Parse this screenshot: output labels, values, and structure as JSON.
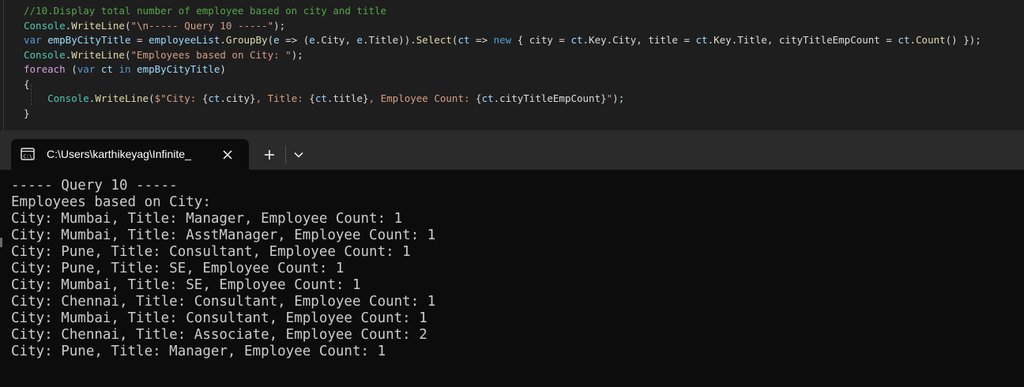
{
  "editor": {
    "lines": [
      [
        {
          "t": "//10.Display total number of employee based on city and title",
          "c": "c-comment"
        }
      ],
      [
        {
          "t": "Console",
          "c": "c-type"
        },
        {
          "t": ".",
          "c": "c-plain"
        },
        {
          "t": "WriteLine",
          "c": "c-method"
        },
        {
          "t": "(",
          "c": "c-plain"
        },
        {
          "t": "\"\\n----- Query 10 -----\"",
          "c": "c-str"
        },
        {
          "t": ");",
          "c": "c-plain"
        }
      ],
      [
        {
          "t": "var",
          "c": "c-kw"
        },
        {
          "t": " ",
          "c": "c-plain"
        },
        {
          "t": "empByCityTitle",
          "c": "c-var"
        },
        {
          "t": " = ",
          "c": "c-plain"
        },
        {
          "t": "employeeList",
          "c": "c-var"
        },
        {
          "t": ".",
          "c": "c-plain"
        },
        {
          "t": "GroupBy",
          "c": "c-method"
        },
        {
          "t": "(",
          "c": "c-plain"
        },
        {
          "t": "e",
          "c": "c-var"
        },
        {
          "t": " => (",
          "c": "c-plain"
        },
        {
          "t": "e",
          "c": "c-var"
        },
        {
          "t": ".City, ",
          "c": "c-plain"
        },
        {
          "t": "e",
          "c": "c-var"
        },
        {
          "t": ".Title)).",
          "c": "c-plain"
        },
        {
          "t": "Select",
          "c": "c-method"
        },
        {
          "t": "(",
          "c": "c-plain"
        },
        {
          "t": "ct",
          "c": "c-var"
        },
        {
          "t": " => ",
          "c": "c-plain"
        },
        {
          "t": "new",
          "c": "c-kw"
        },
        {
          "t": " { city = ",
          "c": "c-plain"
        },
        {
          "t": "ct",
          "c": "c-var"
        },
        {
          "t": ".Key.City, title = ",
          "c": "c-plain"
        },
        {
          "t": "ct",
          "c": "c-var"
        },
        {
          "t": ".Key.Title, cityTitleEmpCount = ",
          "c": "c-plain"
        },
        {
          "t": "ct",
          "c": "c-var"
        },
        {
          "t": ".",
          "c": "c-plain"
        },
        {
          "t": "Count",
          "c": "c-method"
        },
        {
          "t": "() });",
          "c": "c-plain"
        }
      ],
      [
        {
          "t": "Console",
          "c": "c-type"
        },
        {
          "t": ".",
          "c": "c-plain"
        },
        {
          "t": "WriteLine",
          "c": "c-method"
        },
        {
          "t": "(",
          "c": "c-plain"
        },
        {
          "t": "\"Employees based on City: \"",
          "c": "c-str"
        },
        {
          "t": ");",
          "c": "c-plain"
        }
      ],
      [
        {
          "t": "foreach",
          "c": "c-ctl"
        },
        {
          "t": " (",
          "c": "c-plain"
        },
        {
          "t": "var",
          "c": "c-kw"
        },
        {
          "t": " ",
          "c": "c-plain"
        },
        {
          "t": "ct",
          "c": "c-var"
        },
        {
          "t": " ",
          "c": "c-plain"
        },
        {
          "t": "in",
          "c": "c-kw"
        },
        {
          "t": " ",
          "c": "c-plain"
        },
        {
          "t": "empByCityTitle",
          "c": "c-var"
        },
        {
          "t": ")",
          "c": "c-plain"
        }
      ],
      [
        {
          "t": "{",
          "c": "c-plain"
        }
      ],
      [
        {
          "t": "    ",
          "c": "c-plain"
        },
        {
          "t": "Console",
          "c": "c-type"
        },
        {
          "t": ".",
          "c": "c-plain"
        },
        {
          "t": "WriteLine",
          "c": "c-method"
        },
        {
          "t": "(",
          "c": "c-plain"
        },
        {
          "t": "$\"City: ",
          "c": "c-str"
        },
        {
          "t": "{",
          "c": "c-plain"
        },
        {
          "t": "ct",
          "c": "c-var"
        },
        {
          "t": ".city}",
          "c": "c-plain"
        },
        {
          "t": ", Title: ",
          "c": "c-str"
        },
        {
          "t": "{",
          "c": "c-plain"
        },
        {
          "t": "ct",
          "c": "c-var"
        },
        {
          "t": ".title}",
          "c": "c-plain"
        },
        {
          "t": ", Employee Count: ",
          "c": "c-str"
        },
        {
          "t": "{",
          "c": "c-plain"
        },
        {
          "t": "ct",
          "c": "c-var"
        },
        {
          "t": ".cityTitleEmpCount}",
          "c": "c-plain"
        },
        {
          "t": "\"",
          "c": "c-str"
        },
        {
          "t": ");",
          "c": "c-plain"
        }
      ],
      [
        {
          "t": "}",
          "c": "c-plain"
        }
      ]
    ]
  },
  "terminal_tab": {
    "title": "C:\\Users\\karthikeyag\\Infinite_",
    "icon": "console-icon",
    "close_icon": "close-icon",
    "new_tab_icon": "plus-icon",
    "dropdown_icon": "chevron-down-icon"
  },
  "terminal": {
    "lines": [
      "",
      "----- Query 10 -----",
      "Employees based on City:",
      "City: Mumbai, Title: Manager, Employee Count: 1",
      "City: Mumbai, Title: AsstManager, Employee Count: 1",
      "City: Pune, Title: Consultant, Employee Count: 1",
      "City: Pune, Title: SE, Employee Count: 1",
      "City: Mumbai, Title: SE, Employee Count: 1",
      "City: Chennai, Title: Consultant, Employee Count: 1",
      "City: Mumbai, Title: Consultant, Employee Count: 1",
      "City: Chennai, Title: Associate, Employee Count: 2",
      "City: Pune, Title: Manager, Employee Count: 1"
    ]
  },
  "colors": {
    "editor_bg": "#1e1e1e",
    "terminal_bg": "#0c0c0c",
    "tabbar_bg": "#2b2b2b",
    "terminal_text": "#cccccc"
  }
}
